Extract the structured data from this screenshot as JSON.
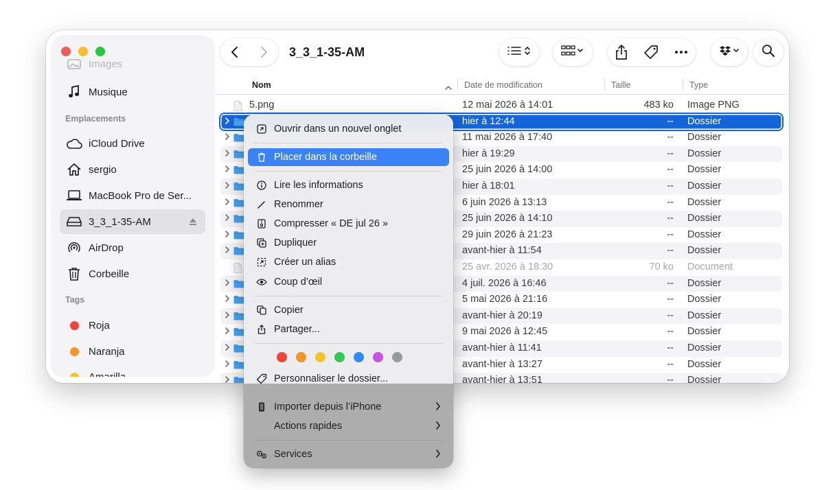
{
  "window": {
    "title": "3_3_1-35-AM"
  },
  "sidebar": {
    "top_items": [
      {
        "label": "Images",
        "icon": "images-icon"
      },
      {
        "label": "Musique",
        "icon": "music-note-icon"
      }
    ],
    "locations_header": "Emplacements",
    "locations": [
      {
        "label": "iCloud Drive",
        "icon": "cloud-icon"
      },
      {
        "label": "sergio",
        "icon": "home-icon"
      },
      {
        "label": "MacBook Pro de Ser...",
        "icon": "laptop-icon"
      },
      {
        "label": "3_3_1-35-AM",
        "icon": "external-drive-icon",
        "selected": true
      },
      {
        "label": "AirDrop",
        "icon": "airdrop-icon"
      },
      {
        "label": "Corbeille",
        "icon": "trash-icon"
      }
    ],
    "tags_header": "Tags",
    "tags": [
      {
        "label": "Roja",
        "color": "#f0453a"
      },
      {
        "label": "Naranja",
        "color": "#f7952a"
      },
      {
        "label": "Amarilla",
        "color": "#f7c32a"
      }
    ]
  },
  "columns": {
    "name": "Nom",
    "date": "Date de modification",
    "size": "Taille",
    "type": "Type"
  },
  "files": [
    {
      "name": "5.png",
      "date": "12 mai 2026 à 14:01",
      "size": "483 ko",
      "type": "Image PNG",
      "kind": "file"
    },
    {
      "name": "",
      "date": "hier à 12:44",
      "size": "--",
      "type": "Dossier",
      "kind": "folder",
      "selected": true
    },
    {
      "name": "",
      "date": "11 mai 2026 à 17:40",
      "size": "--",
      "type": "Dossier",
      "kind": "folder"
    },
    {
      "name": "",
      "date": "hier à 19:29",
      "size": "--",
      "type": "Dossier",
      "kind": "folder"
    },
    {
      "name": "",
      "date": "25 juin 2026 à 14:00",
      "size": "--",
      "type": "Dossier",
      "kind": "folder"
    },
    {
      "name": "",
      "date": "hier à 18:01",
      "size": "--",
      "type": "Dossier",
      "kind": "folder"
    },
    {
      "name": "",
      "date": "6 juin 2026 à 13:13",
      "size": "--",
      "type": "Dossier",
      "kind": "folder"
    },
    {
      "name": "",
      "date": "25 juin 2026 à 14:10",
      "size": "--",
      "type": "Dossier",
      "kind": "folder"
    },
    {
      "name": "",
      "date": "29 juin 2026 à 21:23",
      "size": "--",
      "type": "Dossier",
      "kind": "folder"
    },
    {
      "name": "",
      "date": "avant-hier à 11:54",
      "size": "--",
      "type": "Dossier",
      "kind": "folder"
    },
    {
      "name": "",
      "date": "25 avr. 2026 à 18:30",
      "size": "70 ko",
      "type": "Document",
      "kind": "file",
      "dim": true
    },
    {
      "name": "",
      "date": "4 juil. 2026 à 16:46",
      "size": "--",
      "type": "Dossier",
      "kind": "folder"
    },
    {
      "name": "",
      "date": "5 mai 2026 à 21:16",
      "size": "--",
      "type": "Dossier",
      "kind": "folder"
    },
    {
      "name": "",
      "date": "avant-hier à 20:19",
      "size": "--",
      "type": "Dossier",
      "kind": "folder"
    },
    {
      "name": "",
      "date": "9 mai 2026 à 12:45",
      "size": "--",
      "type": "Dossier",
      "kind": "folder"
    },
    {
      "name": "",
      "date": "avant-hier à 11:41",
      "size": "--",
      "type": "Dossier",
      "kind": "folder"
    },
    {
      "name": "",
      "date": "avant-hier à 13:27",
      "size": "--",
      "type": "Dossier",
      "kind": "folder"
    },
    {
      "name": "",
      "date": "avant-hier à 13:51",
      "size": "--",
      "type": "Dossier",
      "kind": "folder"
    }
  ],
  "context_menu": {
    "open_new_tab": "Ouvrir dans un nouvel onglet",
    "move_to_trash": "Placer dans la corbeille",
    "get_info": "Lire les informations",
    "rename": "Renommer",
    "compress": "Compresser « DE jul 26 »",
    "duplicate": "Dupliquer",
    "make_alias": "Créer un alias",
    "quick_look": "Coup d’œil",
    "copy": "Copier",
    "share": "Partager...",
    "tag_colors": [
      "#f0453a",
      "#f7952a",
      "#f7c32a",
      "#34c759",
      "#2f8cf6",
      "#c653e6",
      "#9a9a9c"
    ],
    "customize_folder": "Personnaliser le dossier...",
    "import_iphone": "Importer depuis l’iPhone",
    "quick_actions": "Actions rapides",
    "services": "Services"
  }
}
